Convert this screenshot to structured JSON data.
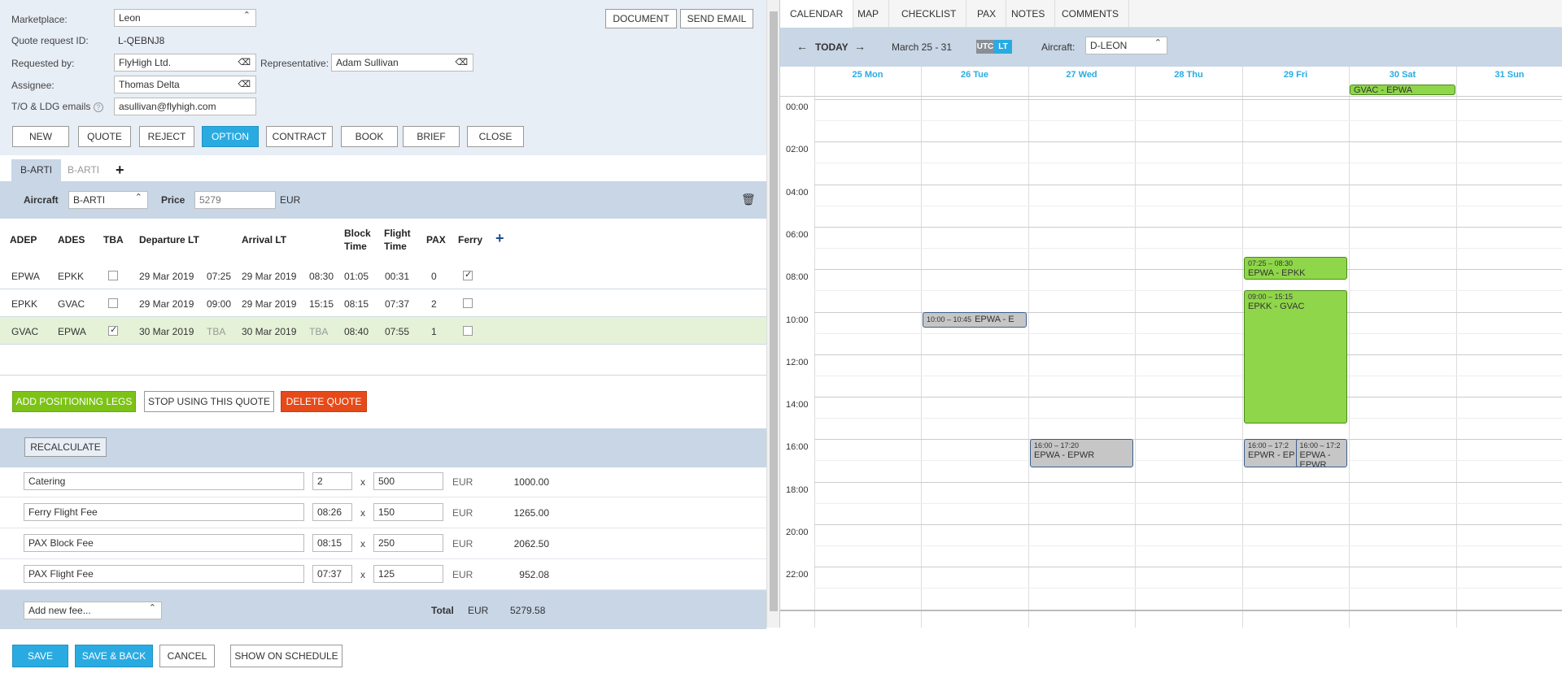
{
  "form": {
    "marketplace_label": "Marketplace:",
    "marketplace_value": "Leon",
    "quote_id_label": "Quote request ID:",
    "quote_id_value": "L-QEBNJ8",
    "requested_by_label": "Requested by:",
    "requested_by_value": "FlyHigh Ltd.",
    "representative_label": "Representative:",
    "representative_value": "Adam Sullivan",
    "assignee_label": "Assignee:",
    "assignee_value": "Thomas Delta",
    "emails_label": "T/O & LDG emails",
    "emails_value": "asullivan@flyhigh.com",
    "document_btn": "DOCUMENT",
    "send_email_btn": "SEND EMAIL"
  },
  "status_buttons": [
    "NEW",
    "QUOTE",
    "REJECT",
    "OPTION",
    "CONTRACT",
    "BOOK",
    "BRIEF",
    "CLOSE"
  ],
  "active_status": "OPTION",
  "quote_tabs": [
    "B-ARTI",
    "B-ARTI"
  ],
  "add_tab": "+",
  "aircraft_bar": {
    "aircraft_label": "Aircraft",
    "aircraft_value": "B-ARTI",
    "price_label": "Price",
    "price_placeholder": "5279",
    "currency": "EUR"
  },
  "legs_header": {
    "adep": "ADEP",
    "ades": "ADES",
    "tba": "TBA",
    "dep": "Departure LT",
    "arr": "Arrival LT",
    "block": "Block",
    "block2": "Time",
    "flight": "Flight",
    "flight2": "Time",
    "pax": "PAX",
    "ferry": "Ferry",
    "add": "+"
  },
  "legs": [
    {
      "adep": "EPWA",
      "ades": "EPKK",
      "tba": false,
      "dep_date": "29 Mar 2019",
      "dep_time": "07:25",
      "arr_date": "29 Mar 2019",
      "arr_time": "08:30",
      "block": "01:05",
      "flight": "00:31",
      "pax": "0",
      "ferry": true
    },
    {
      "adep": "EPKK",
      "ades": "GVAC",
      "tba": false,
      "dep_date": "29 Mar 2019",
      "dep_time": "09:00",
      "arr_date": "29 Mar 2019",
      "arr_time": "15:15",
      "block": "08:15",
      "flight": "07:37",
      "pax": "2",
      "ferry": false
    },
    {
      "adep": "GVAC",
      "ades": "EPWA",
      "tba": true,
      "dep_date": "30 Mar 2019",
      "dep_time": "TBA",
      "arr_date": "30 Mar 2019",
      "arr_time": "TBA",
      "block": "08:40",
      "flight": "07:55",
      "pax": "1",
      "ferry": false
    }
  ],
  "actions": {
    "add_positioning": "ADD POSITIONING LEGS",
    "stop_using": "STOP USING THIS QUOTE",
    "delete_quote": "DELETE QUOTE",
    "recalculate": "RECALCULATE"
  },
  "fees": [
    {
      "name": "Catering",
      "qty": "2",
      "rate": "500",
      "currency": "EUR",
      "total": "1000.00"
    },
    {
      "name": "Ferry Flight Fee",
      "qty": "08:26",
      "rate": "150",
      "currency": "EUR",
      "total": "1265.00"
    },
    {
      "name": "PAX Block Fee",
      "qty": "08:15",
      "rate": "250",
      "currency": "EUR",
      "total": "2062.50"
    },
    {
      "name": "PAX Flight Fee",
      "qty": "07:37",
      "rate": "125",
      "currency": "EUR",
      "total": "952.08"
    }
  ],
  "fee_times": "x",
  "totals": {
    "add_fee_placeholder": "Add new fee...",
    "total_label": "Total",
    "currency": "EUR",
    "total": "5279.58"
  },
  "footer": {
    "save": "SAVE",
    "save_back": "SAVE & BACK",
    "cancel": "CANCEL",
    "show_schedule": "SHOW ON SCHEDULE"
  },
  "calendar": {
    "tabs": [
      "CALENDAR",
      "MAP",
      "CHECKLIST",
      "PAX",
      "NOTES",
      "COMMENTS"
    ],
    "today": "TODAY",
    "range": "March 25 - 31",
    "utc": "UTC",
    "lt": "LT",
    "aircraft_label": "Aircraft:",
    "aircraft_value": "D-LEON",
    "days": [
      "25 Mon",
      "26 Tue",
      "27 Wed",
      "28 Thu",
      "29 Fri",
      "30 Sat",
      "31 Sun"
    ],
    "hours": [
      "00:00",
      "02:00",
      "04:00",
      "06:00",
      "08:00",
      "10:00",
      "12:00",
      "14:00",
      "16:00",
      "18:00",
      "20:00",
      "22:00"
    ],
    "allday_event": "GVAC - EPWA",
    "events": [
      {
        "time": "10:00 – 10:45",
        "label": "EPWA - E"
      },
      {
        "time": "07:25 – 08:30",
        "label": "EPWA - EPKK"
      },
      {
        "time": "09:00 – 15:15",
        "label": "EPKK - GVAC"
      },
      {
        "time": "16:00 – 17:20",
        "label": "EPWA - EPWR"
      },
      {
        "time": "16:00 – 17:2",
        "label": "EPWR - EP"
      },
      {
        "time": "16:00 – 17:2",
        "label": "EPWA - EPWR"
      }
    ]
  },
  "colors": {
    "accent": "#29abe2",
    "green": "#8fd64a",
    "action_green": "#7cc316",
    "danger": "#e64a19",
    "panel": "#c8d6e6"
  }
}
